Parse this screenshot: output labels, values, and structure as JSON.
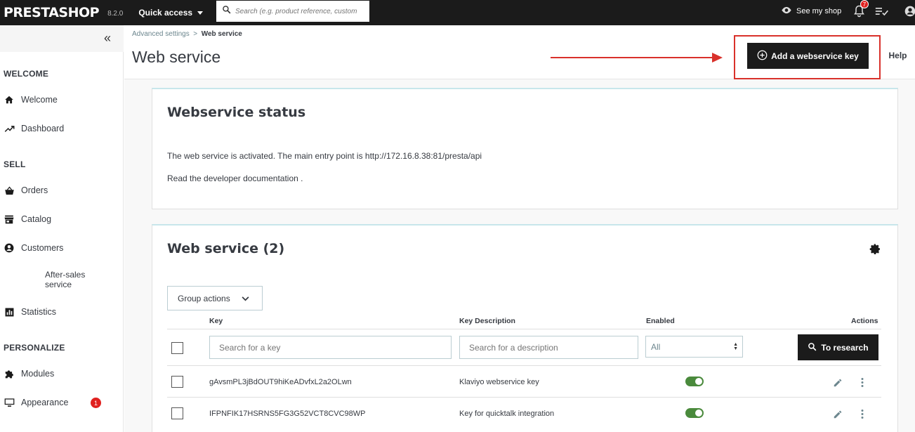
{
  "topbar": {
    "logo": "PRESTASHOP",
    "version": "8.2.0",
    "quick_access": "Quick access",
    "search_placeholder": "Search (e.g. product reference, custom",
    "see_my_shop": "See my shop",
    "notifications_count": "7"
  },
  "sidebar": {
    "collapse_symbol": "«",
    "sections": {
      "welcome": "WELCOME",
      "sell": "SELL",
      "personalize": "PERSONALIZE"
    },
    "items": {
      "welcome": "Welcome",
      "dashboard": "Dashboard",
      "orders": "Orders",
      "catalog": "Catalog",
      "customers": "Customers",
      "after_sales": "After-sales service",
      "statistics": "Statistics",
      "modules": "Modules",
      "appearance": "Appearance",
      "appearance_badge": "1"
    }
  },
  "header": {
    "breadcrumb_parent": "Advanced settings",
    "breadcrumb_sep": ">",
    "breadcrumb_current": "Web service",
    "title": "Web service",
    "add_key_label": "Add a webservice key",
    "help_label": "Help"
  },
  "status_card": {
    "title": "Webservice status",
    "line1_text": "The web service is activated. The main entry point is",
    "line1_link": "http://172.16.8.38:81/presta/api",
    "line2_text": "Read the",
    "line2_link": "developer documentation",
    "line2_end": "."
  },
  "list_card": {
    "title": "Web service (2)",
    "group_actions": "Group actions",
    "columns": {
      "key": "Key",
      "description": "Key Description",
      "enabled": "Enabled",
      "actions": "Actions"
    },
    "filters": {
      "key_placeholder": "Search for a key",
      "description_placeholder": "Search for a description",
      "enabled_value": "All",
      "research_label": "To research"
    },
    "rows": [
      {
        "key": "gAvsmPL3jBdOUT9hiKeADvfxL2a2OLwn",
        "description": "Klaviyo webservice key",
        "enabled": true
      },
      {
        "key": "IFPNFIK17HSRNS5FG3G52VCT8CVC98WP",
        "description": "Key for quicktalk integration",
        "enabled": true
      }
    ]
  },
  "colors": {
    "topbar_bg": "#1b1b1b",
    "accent_red": "#d9312b",
    "toggle_on": "#4a8a3c",
    "card_top_border": "#c7e6eb"
  }
}
